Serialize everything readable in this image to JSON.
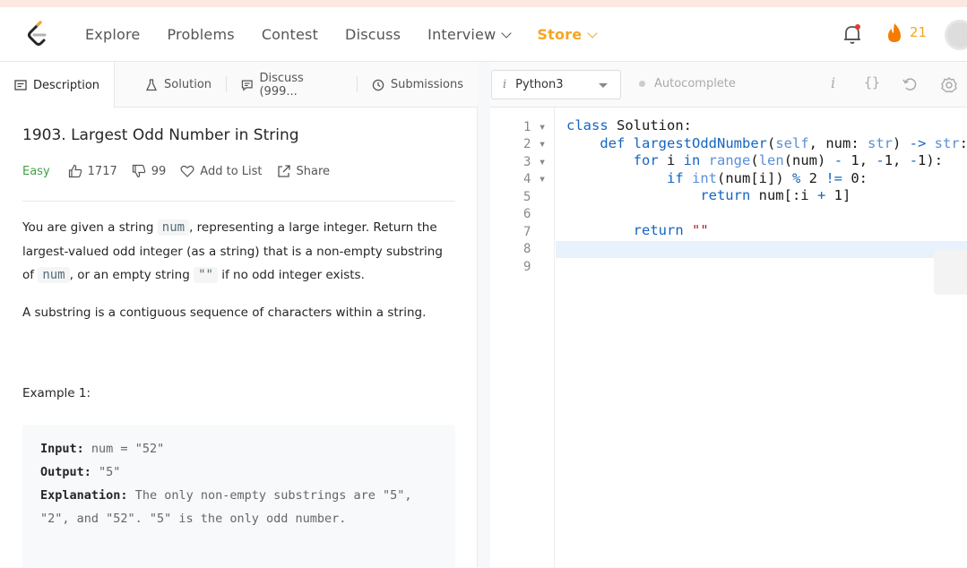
{
  "nav": {
    "items": [
      "Explore",
      "Problems",
      "Contest",
      "Discuss",
      "Interview"
    ],
    "store": "Store",
    "streak": "21"
  },
  "tabs": {
    "description": "Description",
    "solution": "Solution",
    "discuss": "Discuss (999...",
    "submissions": "Submissions"
  },
  "problem": {
    "title": "1903. Largest Odd Number in String",
    "difficulty": "Easy",
    "likes": "1717",
    "dislikes": "99",
    "add_to_list": "Add to List",
    "share": "Share",
    "desc_p1_a": "You are given a string ",
    "desc_code_num": "num",
    "desc_p1_b": ", representing a large integer. Return the largest-valued odd integer (as a string) that is a non-empty substring of ",
    "desc_p1_c": ", or an empty string ",
    "desc_code_empty": "\"\"",
    "desc_p1_d": " if no odd integer exists.",
    "desc_p2": "A substring is a contiguous sequence of characters within a string.",
    "example_title": "Example 1:",
    "example": {
      "input_label": "Input:",
      "input_value": "num = \"52\"",
      "output_label": "Output:",
      "output_value": "\"5\"",
      "explanation_label": "Explanation:",
      "explanation_value": "The only non-empty substrings are \"5\", \"2\", and \"52\". \"5\" is the only odd number."
    }
  },
  "editor": {
    "language": "Python3",
    "autocomplete": "Autocomplete",
    "line_numbers": [
      "1",
      "2",
      "3",
      "4",
      "5",
      "6",
      "7",
      "8",
      "9"
    ]
  }
}
